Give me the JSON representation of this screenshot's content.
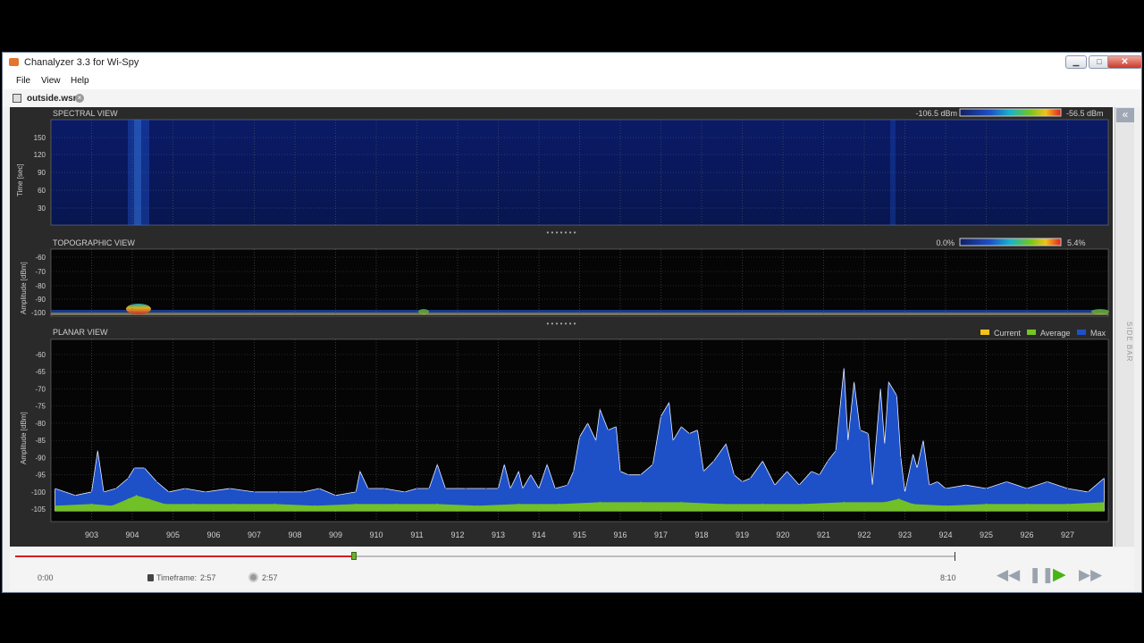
{
  "window": {
    "title": "Chanalyzer 3.3 for Wi-Spy"
  },
  "menu": [
    {
      "label": "File"
    },
    {
      "label": "View"
    },
    {
      "label": "Help"
    }
  ],
  "file_tab": {
    "label": "outside.wsr"
  },
  "spectral": {
    "title": "SPECTRAL VIEW",
    "ylabel": "Time [sec]",
    "yticks": [
      "150",
      "120",
      "90",
      "60",
      "30"
    ],
    "scale_min": "-106.5 dBm",
    "scale_max": "-56.5 dBm"
  },
  "topographic": {
    "title": "TOPOGRAPHIC VIEW",
    "ylabel": "Amplitude [dBm]",
    "yticks": [
      "-60",
      "-70",
      "-80",
      "-90",
      "-100"
    ],
    "scale_min": "0.0%",
    "scale_max": "5.4%"
  },
  "planar": {
    "title": "PLANAR VIEW",
    "ylabel": "Amplitude [dBm]",
    "legend": [
      {
        "label": "Current",
        "color": "#f2c21a"
      },
      {
        "label": "Average",
        "color": "#76c61f"
      },
      {
        "label": "Max",
        "color": "#1e50c8"
      }
    ]
  },
  "x_ticks": [
    "903",
    "904",
    "905",
    "906",
    "907",
    "908",
    "909",
    "910",
    "911",
    "912",
    "913",
    "914",
    "915",
    "916",
    "917",
    "918",
    "919",
    "920",
    "921",
    "922",
    "923",
    "924",
    "925",
    "926",
    "927"
  ],
  "sidebar": {
    "label": "SIDE BAR",
    "collapse": "«"
  },
  "playback": {
    "start": "0:00",
    "timeframe_label": "Timeframe:",
    "timeframe": "2:57",
    "position": "2:57",
    "end": "8:10",
    "position_fraction": 0.36
  },
  "chart_data": {
    "type": "area",
    "title": "PLANAR VIEW",
    "xlabel": "",
    "ylabel": "Amplitude [dBm]",
    "xlim": [
      902.0,
      928.0
    ],
    "ylim": [
      -105,
      -57
    ],
    "y_ticks": [
      -60,
      -65,
      -70,
      -75,
      -80,
      -85,
      -90,
      -95,
      -100,
      -105
    ],
    "grid": true,
    "legend_position": "top-right",
    "series": [
      {
        "name": "Max",
        "color": "#1e50c8",
        "x": [
          902.1,
          902.6,
          903.0,
          903.15,
          903.3,
          903.6,
          903.9,
          904.05,
          904.3,
          904.6,
          904.9,
          905.3,
          905.8,
          906.4,
          907.0,
          907.6,
          908.2,
          908.6,
          909.0,
          909.5,
          909.6,
          909.8,
          910.2,
          910.7,
          911.0,
          911.3,
          911.5,
          911.7,
          912.2,
          912.7,
          913.0,
          913.15,
          913.3,
          913.5,
          913.6,
          913.8,
          914.0,
          914.2,
          914.4,
          914.7,
          914.85,
          915.0,
          915.2,
          915.4,
          915.5,
          915.7,
          915.9,
          916.0,
          916.2,
          916.5,
          916.8,
          917.0,
          917.2,
          917.3,
          917.5,
          917.7,
          917.9,
          918.05,
          918.3,
          918.6,
          918.8,
          919.0,
          919.2,
          919.5,
          919.8,
          920.1,
          920.4,
          920.7,
          920.9,
          921.1,
          921.3,
          921.5,
          921.6,
          921.75,
          921.9,
          922.1,
          922.2,
          922.4,
          922.5,
          922.6,
          922.8,
          922.9,
          923.0,
          923.2,
          923.3,
          923.45,
          923.6,
          923.8,
          924.0,
          924.5,
          925.0,
          925.5,
          926.0,
          926.5,
          927.0,
          927.5,
          927.9
        ],
        "values": [
          -99,
          -101,
          -100,
          -88,
          -100,
          -99,
          -96,
          -93,
          -93,
          -97,
          -100,
          -99,
          -100,
          -99,
          -100,
          -100,
          -100,
          -99,
          -101,
          -100,
          -94,
          -99,
          -99,
          -100,
          -99,
          -99,
          -92,
          -99,
          -99,
          -99,
          -99,
          -92,
          -99,
          -94,
          -99,
          -95,
          -99,
          -92,
          -99,
          -98,
          -94,
          -84,
          -80,
          -85,
          -76,
          -82,
          -81,
          -94,
          -95,
          -95,
          -92,
          -78,
          -74,
          -85,
          -81,
          -83,
          -82,
          -94,
          -91,
          -86,
          -95,
          -97,
          -96,
          -91,
          -98,
          -94,
          -98,
          -94,
          -95,
          -91,
          -88,
          -64,
          -85,
          -68,
          -82,
          -83,
          -98,
          -70,
          -86,
          -68,
          -72,
          -90,
          -100,
          -89,
          -93,
          -85,
          -98,
          -97,
          -99,
          -98,
          -99,
          -97,
          -99,
          -97,
          -99,
          -100,
          -96
        ]
      },
      {
        "name": "Average",
        "color": "#76c61f",
        "x": [
          902.1,
          903.0,
          903.5,
          903.9,
          904.1,
          904.4,
          904.8,
          905.5,
          906.5,
          907.5,
          908.5,
          909.5,
          910.5,
          911.5,
          912.5,
          913.5,
          914.5,
          915.5,
          916.5,
          917.5,
          918.5,
          919.5,
          920.5,
          921.5,
          922.5,
          922.85,
          923.2,
          924.0,
          925.0,
          926.0,
          927.0,
          927.9
        ],
        "values": [
          -104,
          -103.5,
          -104,
          -102,
          -101,
          -102,
          -103.5,
          -103.5,
          -103.5,
          -103.5,
          -104,
          -103.5,
          -103.5,
          -103.5,
          -104,
          -103.5,
          -103.5,
          -103,
          -103,
          -103,
          -103.5,
          -103.5,
          -103.5,
          -103,
          -103,
          -102,
          -103.5,
          -104,
          -103.5,
          -103.5,
          -103.5,
          -103
        ]
      }
    ]
  }
}
